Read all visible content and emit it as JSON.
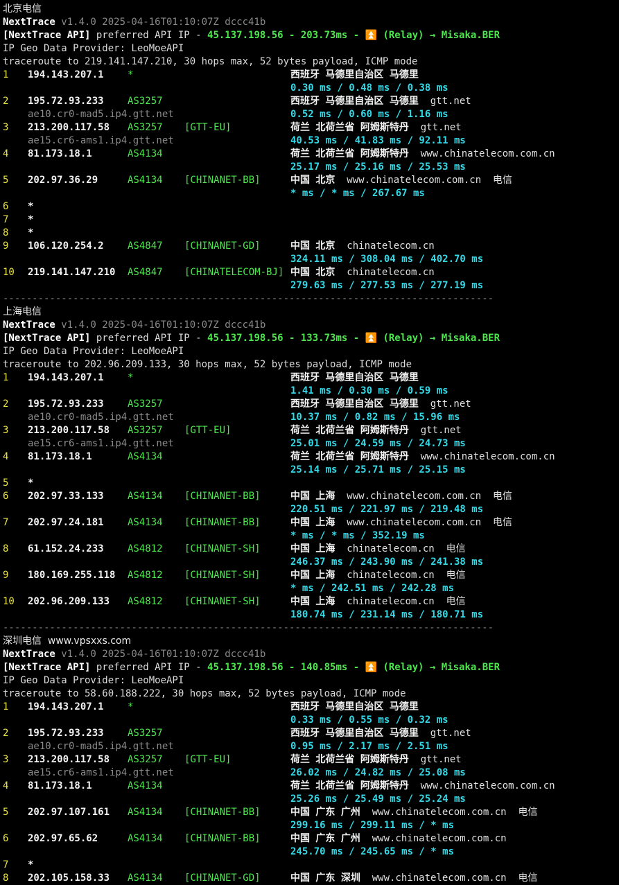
{
  "colors": {
    "background": "#000000",
    "hop": "#e8e244",
    "ip": "#f2f2f2",
    "as": "#4ee64e",
    "rdns": "#8a8a8a",
    "rtt": "#35d8e6",
    "api": "#4ee64e"
  },
  "sections": [
    {
      "label": "北京电信",
      "version_name": "NextTrace",
      "version_info": " v1.4.0 2025-04-16T01:10:07Z dccc41b",
      "api_prefix": "[NextTrace API]",
      "api_mid": " preferred API IP - ",
      "api_ip": "45.137.198.56 - 203.73ms - ⏫ (Relay) → Misaka.BER",
      "geo_provider": "IP Geo Data Provider: LeoMoeAPI",
      "traceroute": "traceroute to 219.141.147.210, 30 hops max, 52 bytes payload, ICMP mode",
      "rows": [
        {
          "hop": "1",
          "ip": "194.143.207.1",
          "as": "*",
          "tag": "",
          "geo": "西班牙 马德里自治区 马德里",
          "domain": "",
          "isp": "",
          "rdns": "",
          "rtt": "0.30 ms / 0.48 ms / 0.38 ms"
        },
        {
          "hop": "2",
          "ip": "195.72.93.233",
          "as": "AS3257",
          "tag": "",
          "geo": "西班牙 马德里自治区 马德里",
          "domain": "gtt.net",
          "isp": "",
          "rdns": "ae10.cr0-mad5.ip4.gtt.net",
          "rtt": "0.52 ms / 0.60 ms / 1.16 ms"
        },
        {
          "hop": "3",
          "ip": "213.200.117.58",
          "as": "AS3257",
          "tag": "[GTT-EU]",
          "geo": "荷兰 北荷兰省 阿姆斯特丹",
          "domain": "gtt.net",
          "isp": "",
          "rdns": "ae15.cr6-ams1.ip4.gtt.net",
          "rtt": "40.53 ms / 41.83 ms / 92.11 ms"
        },
        {
          "hop": "4",
          "ip": "81.173.18.1",
          "as": "AS4134",
          "tag": "",
          "geo": "荷兰 北荷兰省 阿姆斯特丹",
          "domain": "www.chinatelecom.com.cn",
          "isp": "",
          "rdns": "",
          "rtt": "25.17 ms / 25.16 ms / 25.53 ms"
        },
        {
          "hop": "5",
          "ip": "202.97.36.29",
          "as": "AS4134",
          "tag": "[CHINANET-BB]",
          "geo": "中国 北京",
          "domain": "www.chinatelecom.com.cn",
          "isp": "电信",
          "rdns": "",
          "rtt": "* ms / * ms / 267.67 ms"
        },
        {
          "hop": "6",
          "ip": "*",
          "as": "",
          "tag": "",
          "geo": "",
          "domain": "",
          "isp": "",
          "rdns": "",
          "rtt": ""
        },
        {
          "hop": "7",
          "ip": "*",
          "as": "",
          "tag": "",
          "geo": "",
          "domain": "",
          "isp": "",
          "rdns": "",
          "rtt": ""
        },
        {
          "hop": "8",
          "ip": "*",
          "as": "",
          "tag": "",
          "geo": "",
          "domain": "",
          "isp": "",
          "rdns": "",
          "rtt": ""
        },
        {
          "hop": "9",
          "ip": "106.120.254.2",
          "as": "AS4847",
          "tag": "[CHINANET-GD]",
          "geo": "中国 北京",
          "domain": "chinatelecom.cn",
          "isp": "",
          "rdns": "",
          "rtt": "324.11 ms / 308.04 ms / 402.70 ms"
        },
        {
          "hop": "10",
          "ip": "219.141.147.210",
          "as": "AS4847",
          "tag": "[CHINATELECOM-BJ]",
          "geo": "中国 北京",
          "domain": "chinatelecom.cn",
          "isp": "",
          "rdns": "",
          "rtt": "279.63 ms / 277.53 ms / 277.19 ms"
        }
      ]
    },
    {
      "label": "上海电信",
      "version_name": "NextTrace",
      "version_info": " v1.4.0 2025-04-16T01:10:07Z dccc41b",
      "api_prefix": "[NextTrace API]",
      "api_mid": " preferred API IP - ",
      "api_ip": "45.137.198.56 - 133.73ms - ⏫ (Relay) → Misaka.BER",
      "geo_provider": "IP Geo Data Provider: LeoMoeAPI",
      "traceroute": "traceroute to 202.96.209.133, 30 hops max, 52 bytes payload, ICMP mode",
      "rows": [
        {
          "hop": "1",
          "ip": "194.143.207.1",
          "as": "*",
          "tag": "",
          "geo": "西班牙 马德里自治区 马德里",
          "domain": "",
          "isp": "",
          "rdns": "",
          "rtt": "1.41 ms / 0.30 ms / 0.59 ms"
        },
        {
          "hop": "2",
          "ip": "195.72.93.233",
          "as": "AS3257",
          "tag": "",
          "geo": "西班牙 马德里自治区 马德里",
          "domain": "gtt.net",
          "isp": "",
          "rdns": "ae10.cr0-mad5.ip4.gtt.net",
          "rtt": "10.37 ms / 0.82 ms / 15.96 ms"
        },
        {
          "hop": "3",
          "ip": "213.200.117.58",
          "as": "AS3257",
          "tag": "[GTT-EU]",
          "geo": "荷兰 北荷兰省 阿姆斯特丹",
          "domain": "gtt.net",
          "isp": "",
          "rdns": "ae15.cr6-ams1.ip4.gtt.net",
          "rtt": "25.01 ms / 24.59 ms / 24.73 ms"
        },
        {
          "hop": "4",
          "ip": "81.173.18.1",
          "as": "AS4134",
          "tag": "",
          "geo": "荷兰 北荷兰省 阿姆斯特丹",
          "domain": "www.chinatelecom.com.cn",
          "isp": "",
          "rdns": "",
          "rtt": "25.14 ms / 25.71 ms / 25.15 ms"
        },
        {
          "hop": "5",
          "ip": "*",
          "as": "",
          "tag": "",
          "geo": "",
          "domain": "",
          "isp": "",
          "rdns": "",
          "rtt": ""
        },
        {
          "hop": "6",
          "ip": "202.97.33.133",
          "as": "AS4134",
          "tag": "[CHINANET-BB]",
          "geo": "中国 上海",
          "domain": "www.chinatelecom.com.cn",
          "isp": "电信",
          "rdns": "",
          "rtt": "220.51 ms / 221.97 ms / 219.48 ms"
        },
        {
          "hop": "7",
          "ip": "202.97.24.181",
          "as": "AS4134",
          "tag": "[CHINANET-BB]",
          "geo": "中国 上海",
          "domain": "www.chinatelecom.com.cn",
          "isp": "电信",
          "rdns": "",
          "rtt": "* ms / * ms / 352.19 ms"
        },
        {
          "hop": "8",
          "ip": "61.152.24.233",
          "as": "AS4812",
          "tag": "[CHINANET-SH]",
          "geo": "中国 上海",
          "domain": "chinatelecom.cn",
          "isp": "电信",
          "rdns": "",
          "rtt": "246.37 ms / 243.90 ms / 241.38 ms"
        },
        {
          "hop": "9",
          "ip": "180.169.255.118",
          "as": "AS4812",
          "tag": "[CHINANET-SH]",
          "geo": "中国 上海",
          "domain": "chinatelecom.cn",
          "isp": "电信",
          "rdns": "",
          "rtt": "* ms / 242.51 ms / 242.28 ms"
        },
        {
          "hop": "10",
          "ip": "202.96.209.133",
          "as": "AS4812",
          "tag": "[CHINANET-SH]",
          "geo": "中国 上海",
          "domain": "chinatelecom.cn",
          "isp": "电信",
          "rdns": "",
          "rtt": "180.74 ms / 231.14 ms / 180.71 ms"
        }
      ]
    },
    {
      "label": "深圳电信  www.vpsxxs.com",
      "version_name": "NextTrace",
      "version_info": " v1.4.0 2025-04-16T01:10:07Z dccc41b",
      "api_prefix": "[NextTrace API]",
      "api_mid": " preferred API IP - ",
      "api_ip": "45.137.198.56 - 140.85ms - ⏫ (Relay) → Misaka.BER",
      "geo_provider": "IP Geo Data Provider: LeoMoeAPI",
      "traceroute": "traceroute to 58.60.188.222, 30 hops max, 52 bytes payload, ICMP mode",
      "rows": [
        {
          "hop": "1",
          "ip": "194.143.207.1",
          "as": "*",
          "tag": "",
          "geo": "西班牙 马德里自治区 马德里",
          "domain": "",
          "isp": "",
          "rdns": "",
          "rtt": "0.33 ms / 0.55 ms / 0.32 ms"
        },
        {
          "hop": "2",
          "ip": "195.72.93.233",
          "as": "AS3257",
          "tag": "",
          "geo": "西班牙 马德里自治区 马德里",
          "domain": "gtt.net",
          "isp": "",
          "rdns": "ae10.cr0-mad5.ip4.gtt.net",
          "rtt": "0.95 ms / 2.17 ms / 2.51 ms"
        },
        {
          "hop": "3",
          "ip": "213.200.117.58",
          "as": "AS3257",
          "tag": "[GTT-EU]",
          "geo": "荷兰 北荷兰省 阿姆斯特丹",
          "domain": "gtt.net",
          "isp": "",
          "rdns": "ae15.cr6-ams1.ip4.gtt.net",
          "rtt": "26.02 ms / 24.82 ms / 25.08 ms"
        },
        {
          "hop": "4",
          "ip": "81.173.18.1",
          "as": "AS4134",
          "tag": "",
          "geo": "荷兰 北荷兰省 阿姆斯特丹",
          "domain": "www.chinatelecom.com.cn",
          "isp": "",
          "rdns": "",
          "rtt": "25.26 ms / 25.49 ms / 25.24 ms"
        },
        {
          "hop": "5",
          "ip": "202.97.107.161",
          "as": "AS4134",
          "tag": "[CHINANET-BB]",
          "geo": "中国 广东 广州",
          "domain": "www.chinatelecom.com.cn",
          "isp": "电信",
          "rdns": "",
          "rtt": "299.16 ms / 299.11 ms / * ms"
        },
        {
          "hop": "6",
          "ip": "202.97.65.62",
          "as": "AS4134",
          "tag": "[CHINANET-BB]",
          "geo": "中国 广东 广州",
          "domain": "www.chinatelecom.com.cn",
          "isp": "",
          "rdns": "",
          "rtt": "245.70 ms / 245.65 ms / * ms"
        },
        {
          "hop": "7",
          "ip": "*",
          "as": "",
          "tag": "",
          "geo": "",
          "domain": "",
          "isp": "",
          "rdns": "",
          "rtt": ""
        },
        {
          "hop": "8",
          "ip": "202.105.158.33",
          "as": "AS4134",
          "tag": "[CHINANET-GD]",
          "geo": "中国 广东 深圳",
          "domain": "www.chinatelecom.com.cn",
          "isp": "电信",
          "rdns": "",
          "rtt": ""
        }
      ]
    }
  ],
  "separator": "------------------------------------------------------------------------------------"
}
